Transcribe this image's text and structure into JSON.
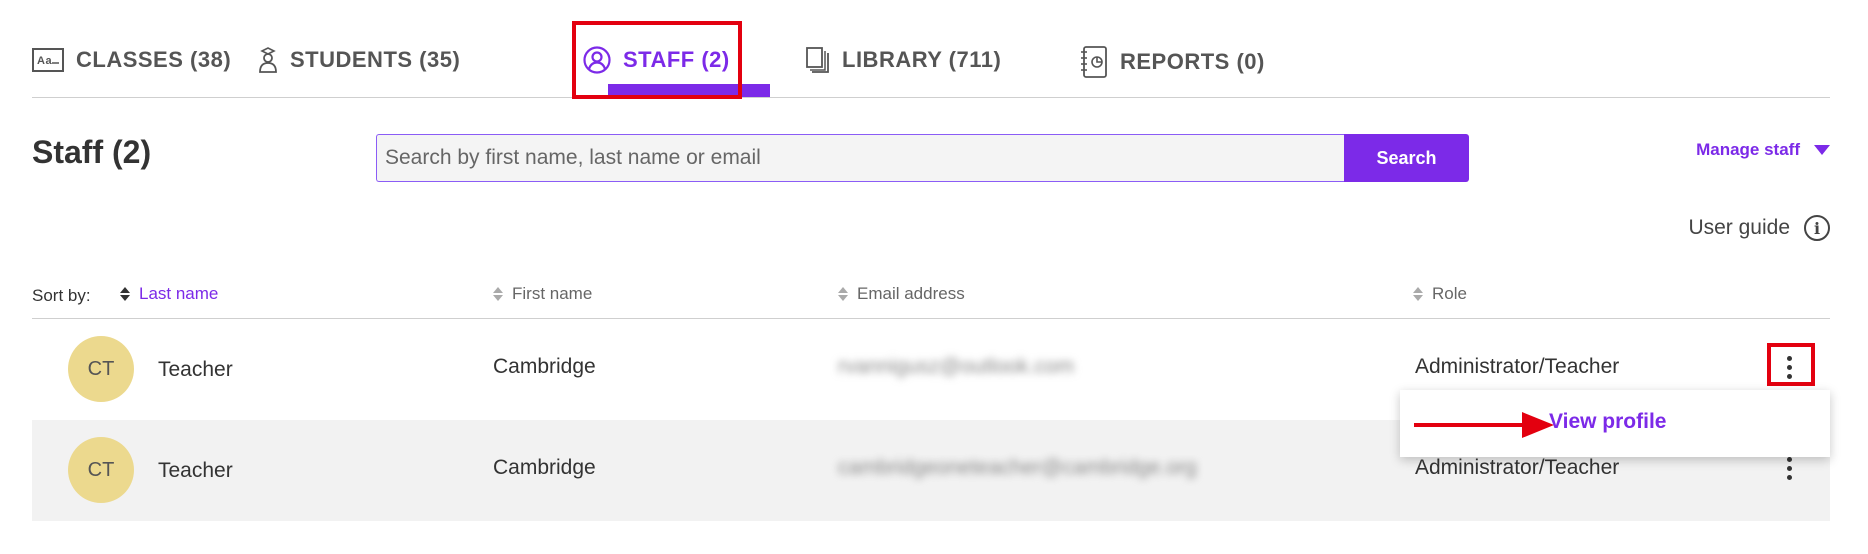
{
  "tabs": [
    {
      "label": "CLASSES (38)",
      "icon": "class-icon"
    },
    {
      "label": "STUDENTS (35)",
      "icon": "student-icon"
    },
    {
      "label": "STAFF (2)",
      "icon": "user-circle-icon",
      "active": true
    },
    {
      "label": "LIBRARY (711)",
      "icon": "library-icon"
    },
    {
      "label": "REPORTS (0)",
      "icon": "reports-icon"
    }
  ],
  "page": {
    "title": "Staff (2)"
  },
  "search": {
    "placeholder": "Search by first name, last name or email",
    "button_label": "Search"
  },
  "manage_staff_label": "Manage staff",
  "user_guide_label": "User guide",
  "sort": {
    "label": "Sort by:",
    "columns": [
      "Last name",
      "First name",
      "Email address",
      "Role"
    ],
    "active": "Last name"
  },
  "rows": [
    {
      "initials": "CT",
      "last_name": "Teacher",
      "first_name": "Cambridge",
      "email": "rvannigusz@outlook.com",
      "role": "Administrator/Teacher"
    },
    {
      "initials": "CT",
      "last_name": "Teacher",
      "first_name": "Cambridge",
      "email": "cambridgeoneteacher@cambridge.org",
      "role": "Administrator/Teacher"
    }
  ],
  "menu": {
    "view_profile_label": "View profile"
  },
  "colors": {
    "accent": "#7c2ae8",
    "highlight": "#e3000f",
    "avatar": "#ecd98e",
    "row_alt": "#f2f2f2"
  }
}
